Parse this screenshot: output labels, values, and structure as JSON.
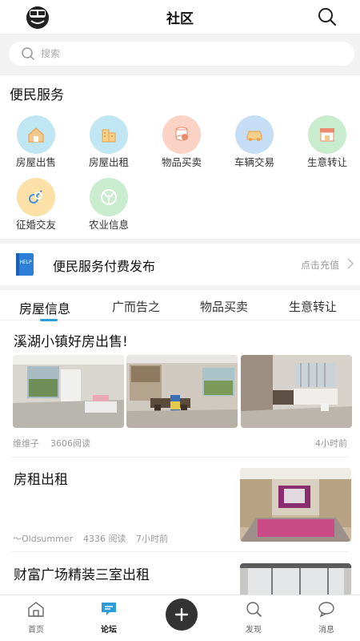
{
  "header": {
    "title": "社区"
  },
  "search": {
    "placeholder": "搜索"
  },
  "services": {
    "title": "便民服务",
    "items": [
      {
        "label": "房屋出售",
        "icon": "house-icon",
        "color": "#bfe6f2"
      },
      {
        "label": "房屋出租",
        "icon": "building-icon",
        "color": "#bfe6f2"
      },
      {
        "label": "物品买卖",
        "icon": "coins-icon",
        "color": "#fbd3c4"
      },
      {
        "label": "车辆交易",
        "icon": "car-icon",
        "color": "#c6def5"
      },
      {
        "label": "生意转让",
        "icon": "shop-icon",
        "color": "#c8eccd"
      },
      {
        "label": "征婚交友",
        "icon": "gender-icon",
        "color": "#fbe1a8"
      },
      {
        "label": "农业信息",
        "icon": "sprout-icon",
        "color": "#c8eccd"
      }
    ]
  },
  "paybar": {
    "title": "便民服务付费发布",
    "action": "点击充值",
    "badge": "HELP"
  },
  "tabs": [
    "房屋信息",
    "广而告之",
    "物品买卖",
    "生意转让"
  ],
  "posts": [
    {
      "title": "溪湖小镇好房出售!",
      "author": "维维子",
      "reads": "3606阅读",
      "time": "4小时前"
    },
    {
      "title": "房租出租",
      "author": "～Oldsummer",
      "reads": "4336 阅读",
      "time": "7小时前"
    },
    {
      "title": "财富广场精装三室出租"
    }
  ],
  "nav": {
    "items": [
      {
        "label": "首页",
        "icon": "home-icon"
      },
      {
        "label": "论坛",
        "icon": "forum-icon"
      },
      {
        "label": "发现",
        "icon": "search-icon"
      },
      {
        "label": "消息",
        "icon": "message-icon"
      }
    ]
  },
  "colors": {
    "accent": "#2d9cdb",
    "divider": "#f2f2f2"
  }
}
